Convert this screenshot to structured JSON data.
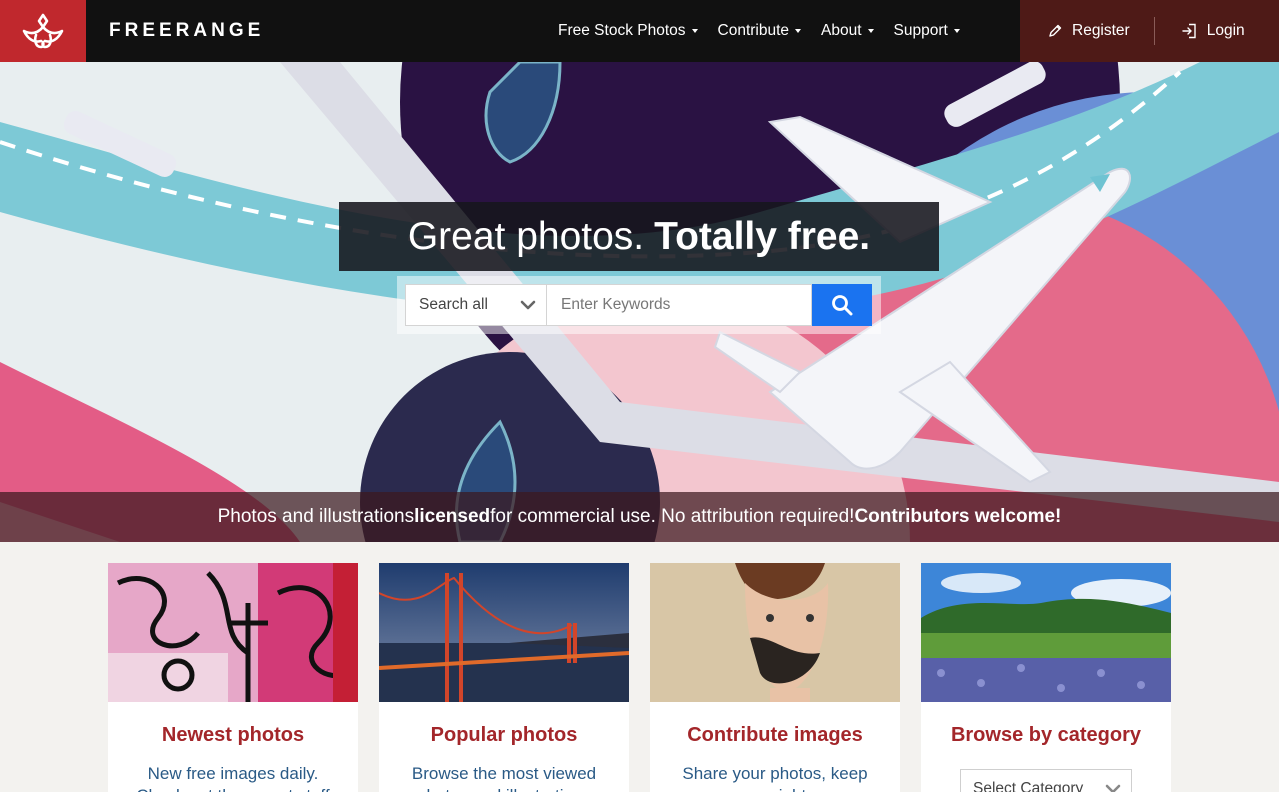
{
  "brand": {
    "name": "FREERANGE"
  },
  "nav": {
    "items": [
      {
        "label": "Free Stock Photos"
      },
      {
        "label": "Contribute"
      },
      {
        "label": "About"
      },
      {
        "label": "Support"
      }
    ],
    "register_label": "Register",
    "login_label": "Login"
  },
  "hero": {
    "headline_regular": "Great photos.",
    "headline_bold": "Totally free.",
    "search": {
      "select_value": "Search all",
      "placeholder": "Enter Keywords"
    },
    "tagline": {
      "part1": "Photos and illustrations ",
      "bold1": "licensed",
      "part2": " for commercial use. No attribution required! ",
      "bold2": "Contributors welcome!"
    }
  },
  "cards": [
    {
      "title": "Newest photos",
      "desc": "New free images daily. Check out the recent stuff"
    },
    {
      "title": "Popular photos",
      "desc": "Browse the most viewed photos and illustrations"
    },
    {
      "title": "Contribute images",
      "desc": "Share your photos, keep your rights"
    },
    {
      "title": "Browse by category",
      "select_value": "Select Category"
    }
  ],
  "colors": {
    "nav_bg": "#111111",
    "logo_red": "#c0282d",
    "account_bg": "#4e1a17",
    "search_blue": "#1a73f0",
    "card_title": "#a3262a",
    "card_desc": "#2a5a86"
  },
  "icons": [
    "freerange-logo-icon",
    "pencil-icon",
    "login-icon",
    "chevron-down-icon",
    "search-icon"
  ]
}
